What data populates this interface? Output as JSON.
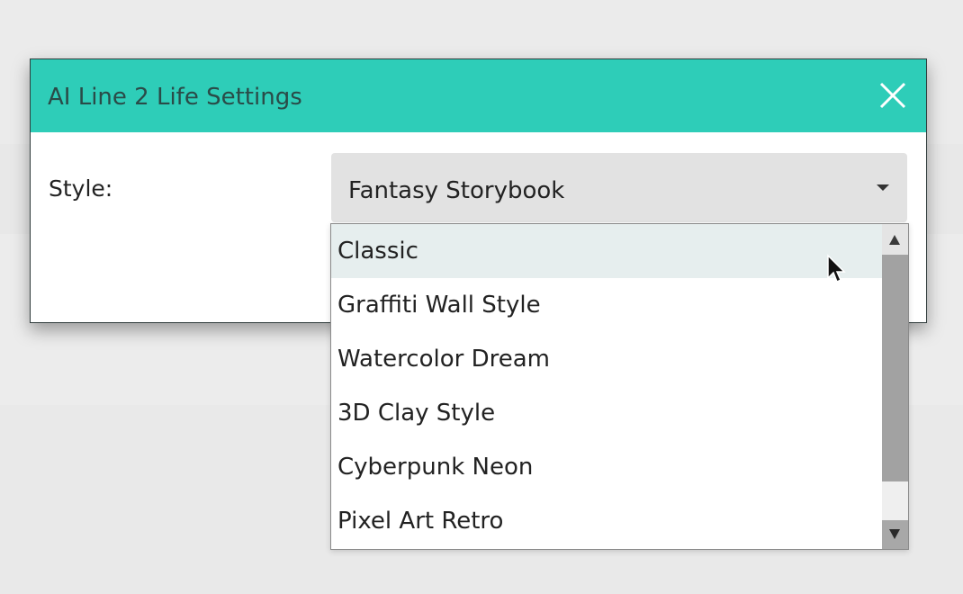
{
  "dialog": {
    "title": "AI Line 2 Life Settings",
    "close_icon": "close-icon",
    "accent_color": "#2ecdb8"
  },
  "style": {
    "label": "Style:",
    "selected": "Fantasy Storybook",
    "arrow_icon": "chevron-down-icon"
  },
  "dropdown": {
    "options": [
      {
        "label": "Classic",
        "highlighted": true
      },
      {
        "label": "Graffiti Wall Style"
      },
      {
        "label": "Watercolor Dream"
      },
      {
        "label": "3D Clay Style"
      },
      {
        "label": "Cyberpunk Neon"
      },
      {
        "label": "Pixel Art Retro"
      }
    ],
    "scroll_up_icon": "arrow-up-icon",
    "scroll_down_icon": "arrow-down-icon"
  }
}
